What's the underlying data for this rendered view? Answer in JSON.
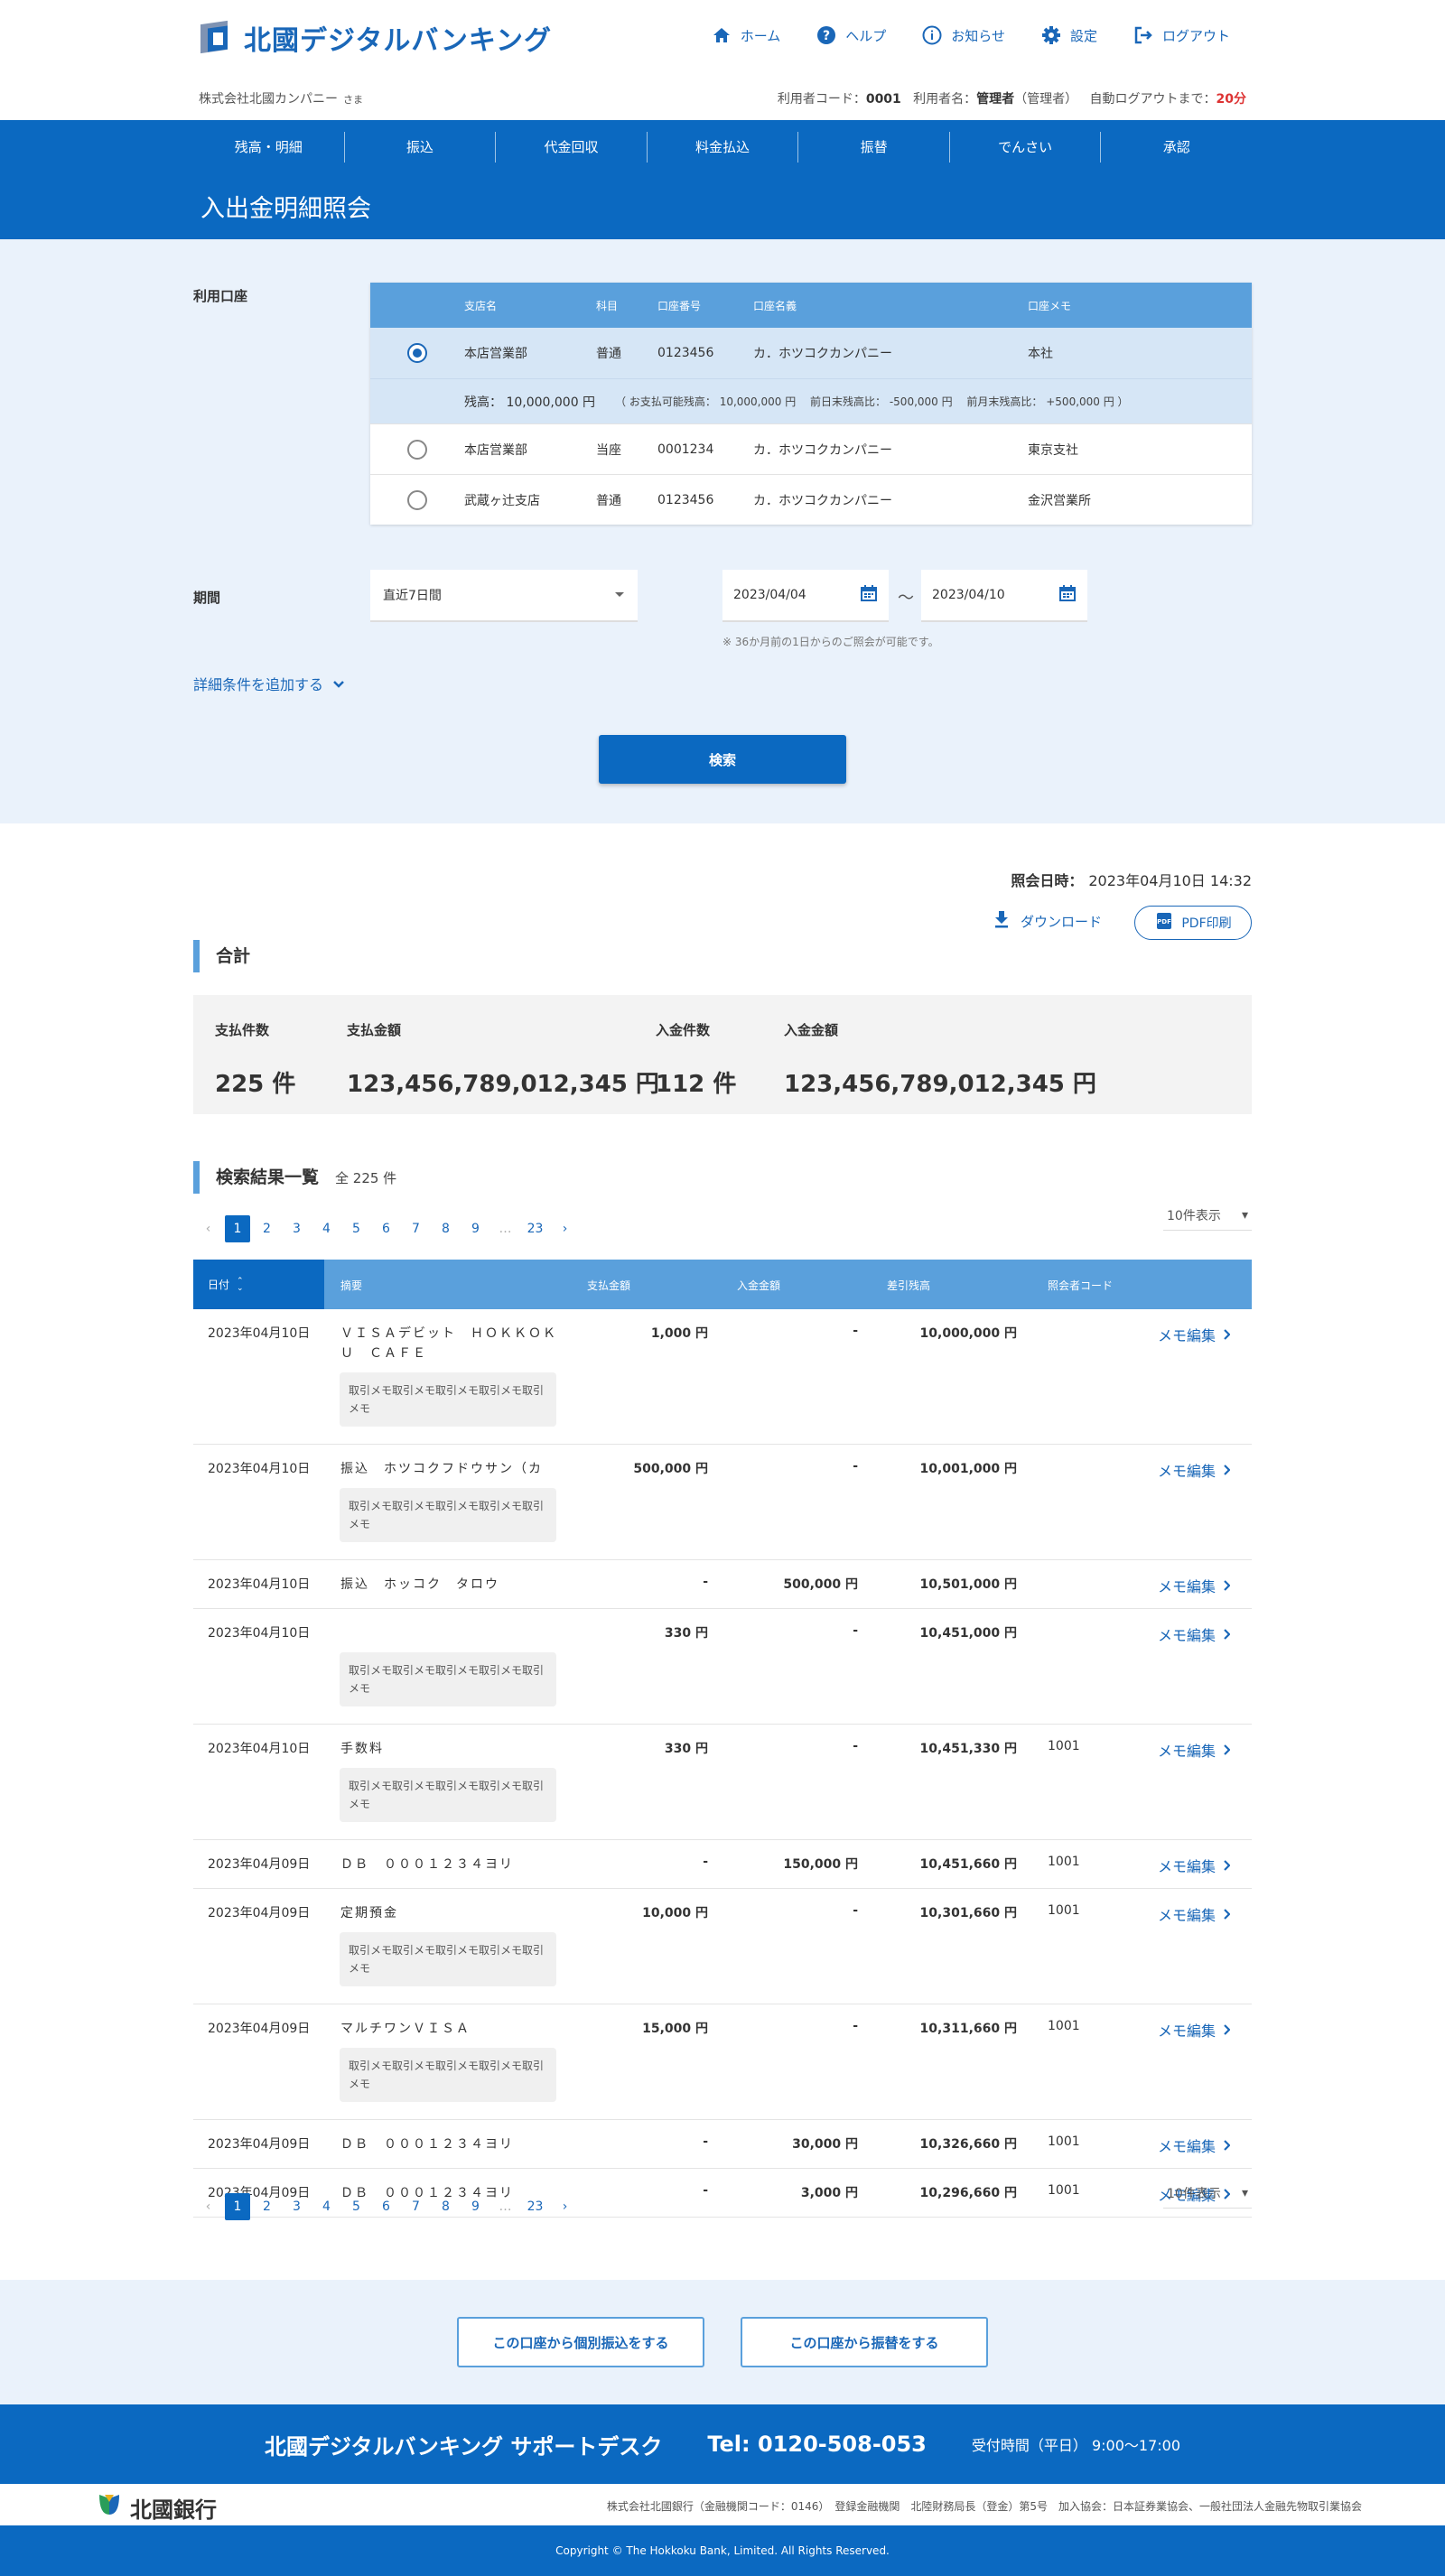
{
  "header": {
    "logo_text": "北國デジタルバンキング",
    "nav": [
      {
        "label": "ホーム",
        "icon": "home-icon"
      },
      {
        "label": "ヘルプ",
        "icon": "help-icon"
      },
      {
        "label": "お知らせ",
        "icon": "info-icon"
      },
      {
        "label": "設定",
        "icon": "gear-icon"
      },
      {
        "label": "ログアウト",
        "icon": "logout-icon"
      }
    ],
    "company": "株式会社北國カンパニー",
    "honorific": "さま",
    "user_code_label": "利用者コード：",
    "user_code": "0001",
    "user_name_label": "利用者名：",
    "user_name": "管理者",
    "user_role": "（管理者）",
    "auto_logout_label": "自動ログアウトまで：",
    "auto_logout": "20分"
  },
  "main_nav": [
    "残高・明細",
    "振込",
    "代金回収",
    "料金払込",
    "振替",
    "でんさい",
    "承認"
  ],
  "page_title": "入出金明細照会",
  "search": {
    "account_label": "利用口座",
    "columns": [
      "支店名",
      "科目",
      "口座番号",
      "口座名義",
      "口座メモ"
    ],
    "accounts": [
      {
        "branch": "本店営業部",
        "type": "普通",
        "number": "0123456",
        "holder": "カ．ホツコクカンパニー",
        "memo": "本社",
        "selected": true
      },
      {
        "branch": "本店営業部",
        "type": "当座",
        "number": "0001234",
        "holder": "カ．ホツコクカンパニー",
        "memo": "東京支社",
        "selected": false
      },
      {
        "branch": "武蔵ヶ辻支店",
        "type": "普通",
        "number": "0123456",
        "holder": "カ．ホツコクカンパニー",
        "memo": "金沢営業所",
        "selected": false
      }
    ],
    "balance": "残高： 10,000,000 円",
    "balance_sub": "（ お支払可能残高： 10,000,000 円　 前日末残高比： -500,000 円　 前月末残高比： +500,000 円 ）",
    "period_label": "期間",
    "period_value": "直近7日間",
    "date_from": "2023/04/04",
    "date_to": "2023/04/10",
    "tilde": "～",
    "note": "※ 36か月前の1日からのご照会が可能です。",
    "more_conditions": "詳細条件を追加する",
    "search_button": "検索"
  },
  "results": {
    "query_time_label": "照会日時：",
    "query_time": "2023年04月10日 14:32",
    "download": "ダウンロード",
    "pdf": "PDF印刷",
    "totals_title": "合計",
    "totals": [
      {
        "label": "支払件数",
        "value": "225 件"
      },
      {
        "label": "支払金額",
        "value": "123,456,789,012,345 円"
      },
      {
        "label": "入金件数",
        "value": "112 件"
      },
      {
        "label": "入金金額",
        "value": "123,456,789,012,345 円"
      }
    ],
    "list_title": "検索結果一覧",
    "list_count": "全 225 件",
    "pages": [
      "1",
      "2",
      "3",
      "4",
      "5",
      "6",
      "7",
      "8",
      "9",
      "…",
      "23"
    ],
    "per_page": "10件表示",
    "columns": [
      "日付",
      "摘要",
      "支払金額",
      "入金金額",
      "差引残高",
      "照会者コード"
    ],
    "memo_edit": "メモ編集",
    "rows": [
      {
        "date": "2023年04月10日",
        "desc": "ＶＩＳＡデビット　ＨＯＫＫＯＫＵ　ＣＡＦＥ",
        "memo": "取引メモ取引メモ取引メモ取引メモ取引メモ",
        "out": "1,000 円",
        "in": "-",
        "balance": "10,000,000 円",
        "code": ""
      },
      {
        "date": "2023年04月10日",
        "desc": "振込　ホツコクフドウサン（カ",
        "memo": "取引メモ取引メモ取引メモ取引メモ取引メモ",
        "out": "500,000 円",
        "in": "-",
        "balance": "10,001,000 円",
        "code": ""
      },
      {
        "date": "2023年04月10日",
        "desc": "振込　ホッコク　タロウ",
        "memo": "",
        "out": "-",
        "in": "500,000 円",
        "balance": "10,501,000 円",
        "code": ""
      },
      {
        "date": "2023年04月10日",
        "desc": "",
        "memo": "取引メモ取引メモ取引メモ取引メモ取引メモ",
        "out": "330 円",
        "in": "-",
        "balance": "10,451,000 円",
        "code": ""
      },
      {
        "date": "2023年04月10日",
        "desc": "手数料",
        "memo": "取引メモ取引メモ取引メモ取引メモ取引メモ",
        "out": "330 円",
        "in": "-",
        "balance": "10,451,330 円",
        "code": "1001"
      },
      {
        "date": "2023年04月09日",
        "desc": "ＤＢ　０００１２３４ヨリ",
        "memo": "",
        "out": "-",
        "in": "150,000 円",
        "balance": "10,451,660 円",
        "code": "1001"
      },
      {
        "date": "2023年04月09日",
        "desc": "定期預金",
        "memo": "取引メモ取引メモ取引メモ取引メモ取引メモ",
        "out": "10,000 円",
        "in": "-",
        "balance": "10,301,660 円",
        "code": "1001"
      },
      {
        "date": "2023年04月09日",
        "desc": "マルチワンＶＩＳＡ",
        "memo": "取引メモ取引メモ取引メモ取引メモ取引メモ",
        "out": "15,000 円",
        "in": "-",
        "balance": "10,311,660 円",
        "code": "1001"
      },
      {
        "date": "2023年04月09日",
        "desc": "ＤＢ　０００１２３４ヨリ",
        "memo": "",
        "out": "-",
        "in": "30,000 円",
        "balance": "10,326,660 円",
        "code": "1001"
      },
      {
        "date": "2023年04月09日",
        "desc": "ＤＢ　０００１２３４ヨリ",
        "memo": "",
        "out": "-",
        "in": "3,000 円",
        "balance": "10,296,660 円",
        "code": "1001"
      }
    ]
  },
  "bottom_buttons": [
    "この口座から個別振込をする",
    "この口座から振替をする"
  ],
  "footer": {
    "support_name": "北國デジタルバンキング サポートデスク",
    "tel": "Tel: 0120-508-053",
    "hours": "受付時間（平日） 9:00～17:00",
    "bank_name": "北國銀行",
    "corp_info": "株式会社北國銀行（金融機関コード：0146）　登録金融機関　北陸財務局長（登金）第5号　加入協会：日本証券業協会、一般社団法人金融先物取引業協会",
    "copyright": "Copyright © The Hokkoku Bank, Limited. All Rights Reserved."
  }
}
